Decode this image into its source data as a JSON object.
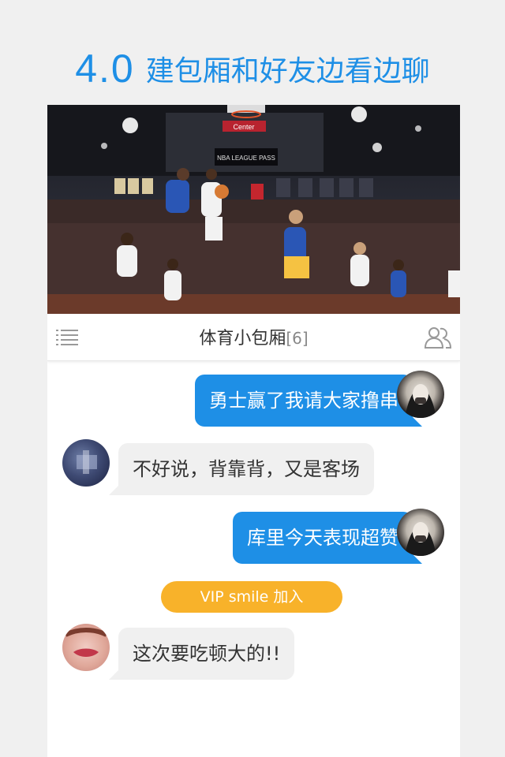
{
  "headline": {
    "version": "4.0",
    "slogan": "建包厢和好友边看边聊"
  },
  "hero": {
    "banner_text": "NBA LEAGUE PASS",
    "arena_sign": "Center"
  },
  "room": {
    "title": "体育小包厢",
    "member_count": "[6]"
  },
  "messages": [
    {
      "side": "out",
      "text": "勇士赢了我请大家撸串"
    },
    {
      "side": "in",
      "text": "不好说，背靠背，又是客场"
    },
    {
      "side": "out",
      "text": "库里今天表现超赞"
    },
    {
      "side": "in",
      "text": "这次要吃顿大的!!"
    }
  ],
  "system_notice": {
    "text": "VIP smile 加入"
  },
  "colors": {
    "accent": "#1e8fe6",
    "notice": "#f8b22a",
    "incoming_bubble": "#f0f0f0"
  },
  "icons": {
    "menu": "list-menu-icon",
    "members": "members-icon"
  }
}
